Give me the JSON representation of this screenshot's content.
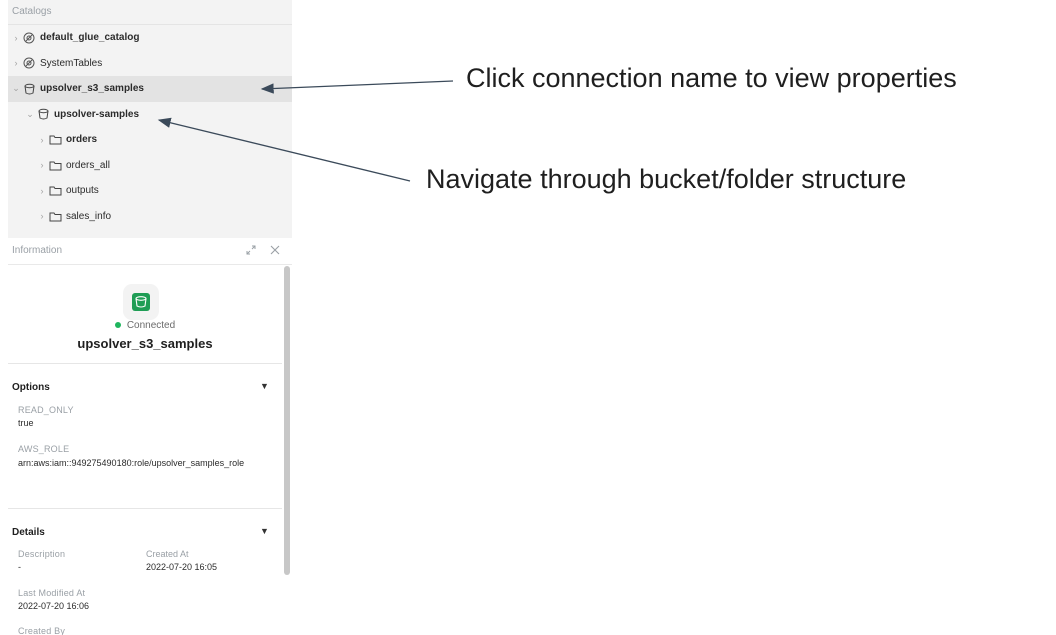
{
  "catalogs": {
    "header": "Catalogs",
    "items": [
      {
        "label": "default_glue_catalog",
        "bold": true
      },
      {
        "label": "SystemTables",
        "bold": false
      },
      {
        "label": "upsolver_s3_samples",
        "bold": true
      },
      {
        "label": "upsolver-samples",
        "bold": true
      },
      {
        "label": "orders",
        "bold": true
      },
      {
        "label": "orders_all",
        "bold": false
      },
      {
        "label": "outputs",
        "bold": false
      },
      {
        "label": "sales_info",
        "bold": false
      }
    ]
  },
  "info_panel": {
    "title": "Information",
    "status": "Connected",
    "connection_name": "upsolver_s3_samples",
    "options": {
      "title": "Options",
      "read_only_label": "READ_ONLY",
      "read_only_value": "true",
      "aws_role_label": "AWS_ROLE",
      "aws_role_value": "arn:aws:iam::949275490180:role/upsolver_samples_role"
    },
    "details": {
      "title": "Details",
      "description_label": "Description",
      "description_value": "-",
      "created_at_label": "Created At",
      "created_at_value": "2022-07-20 16:05",
      "last_modified_label": "Last Modified At",
      "last_modified_value": "2022-07-20 16:06",
      "created_by_label": "Created By"
    }
  },
  "annotations": {
    "connection": "Click connection name to view properties",
    "navigate": "Navigate through bucket/folder structure"
  },
  "colors": {
    "connected": "#1fb55e",
    "bucket_green": "#1f9d55",
    "arrow": "#3b4a5a"
  }
}
